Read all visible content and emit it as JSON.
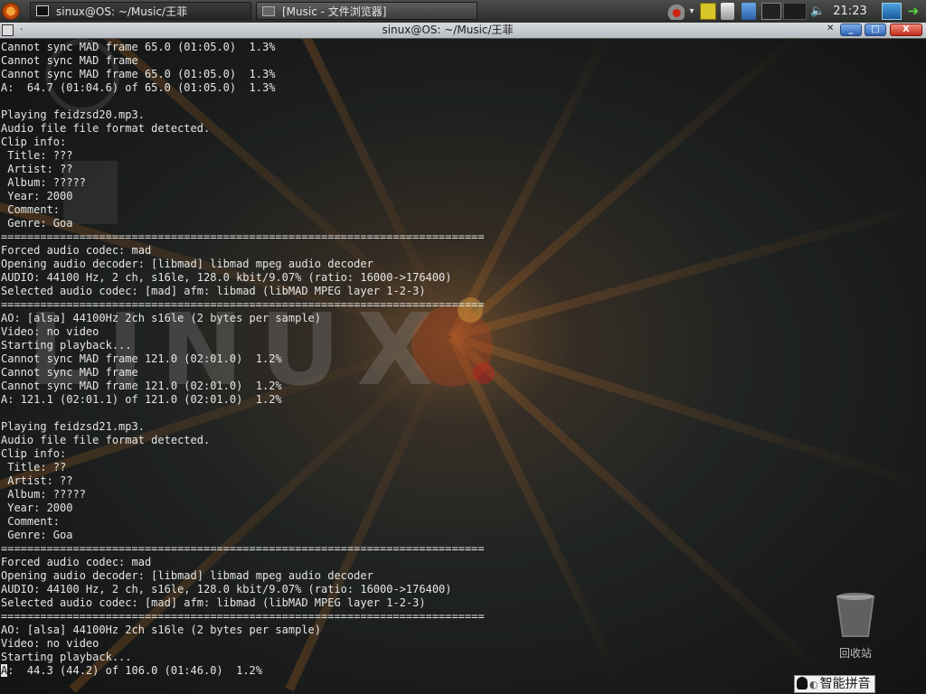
{
  "panel": {
    "tasks": [
      {
        "label": "sinux@OS: ~/Music/王菲",
        "icon": "terminal-icon"
      },
      {
        "label": "[Music - 文件浏览器]",
        "icon": "folder-icon"
      }
    ],
    "clock": "21:23",
    "tray_icons": [
      "network-icon",
      "dropdown-icon",
      "notes-icon",
      "clipboard-icon",
      "files-icon",
      "display-icon",
      "workspace-icon",
      "volume-icon",
      "network-status-icon",
      "logout-icon"
    ]
  },
  "window": {
    "title": "sinux@OS: ~/Music/王菲",
    "menu_dot": "·",
    "buttons": {
      "minimize": "_",
      "maximize": "□",
      "close": "X"
    }
  },
  "terminal": {
    "lines": [
      "Cannot sync MAD frame 65.0 (01:05.0)  1.3%",
      "Cannot sync MAD frame",
      "Cannot sync MAD frame 65.0 (01:05.0)  1.3%",
      "A:  64.7 (01:04.6) of 65.0 (01:05.0)  1.3%",
      "",
      "Playing feidzsd20.mp3.",
      "Audio file file format detected.",
      "Clip info:",
      " Title: ???",
      " Artist: ??",
      " Album: ?????",
      " Year: 2000",
      " Comment:",
      " Genre: Goa",
      "==========================================================================",
      "Forced audio codec: mad",
      "Opening audio decoder: [libmad] libmad mpeg audio decoder",
      "AUDIO: 44100 Hz, 2 ch, s16le, 128.0 kbit/9.07% (ratio: 16000->176400)",
      "Selected audio codec: [mad] afm: libmad (libMAD MPEG layer 1-2-3)",
      "==========================================================================",
      "AO: [alsa] 44100Hz 2ch s16le (2 bytes per sample)",
      "Video: no video",
      "Starting playback...",
      "Cannot sync MAD frame 121.0 (02:01.0)  1.2%",
      "Cannot sync MAD frame",
      "Cannot sync MAD frame 121.0 (02:01.0)  1.2%",
      "A: 121.1 (02:01.1) of 121.0 (02:01.0)  1.2%",
      "",
      "Playing feidzsd21.mp3.",
      "Audio file file format detected.",
      "Clip info:",
      " Title: ??",
      " Artist: ??",
      " Album: ?????",
      " Year: 2000",
      " Comment:",
      " Genre: Goa",
      "==========================================================================",
      "Forced audio codec: mad",
      "Opening audio decoder: [libmad] libmad mpeg audio decoder",
      "AUDIO: 44100 Hz, 2 ch, s16le, 128.0 kbit/9.07% (ratio: 16000->176400)",
      "Selected audio codec: [mad] afm: libmad (libMAD MPEG layer 1-2-3)",
      "==========================================================================",
      "AO: [alsa] 44100Hz 2ch s16le (2 bytes per sample)",
      "Video: no video",
      "Starting playback..."
    ],
    "cursor_char": "A",
    "last_line_rest": ":  44.3 (44.2) of 106.0 (01:46.0)  1.2%"
  },
  "desktop": {
    "wallpaper_text": "LINUX",
    "trash_label": "回收站",
    "ime_label": "智能拼音"
  },
  "colors": {
    "terminal_text": "#e6e6e6",
    "wallpaper_glow": "#d27828"
  }
}
